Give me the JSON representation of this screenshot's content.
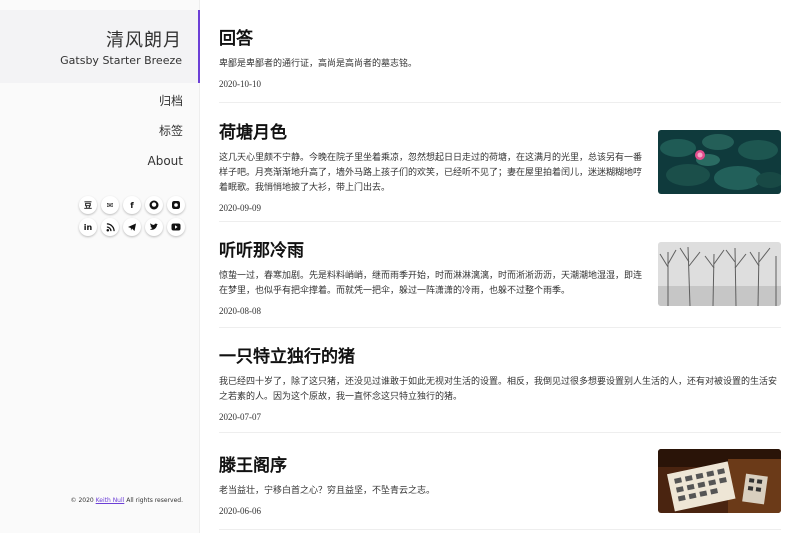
{
  "site": {
    "title": "清风朗月",
    "subtitle": "Gatsby Starter Breeze"
  },
  "nav": [
    {
      "label": "归档"
    },
    {
      "label": "标签"
    },
    {
      "label": "About"
    }
  ],
  "social": [
    {
      "icon": "douban-icon",
      "glyph": "豆"
    },
    {
      "icon": "mail-icon",
      "glyph": "✉"
    },
    {
      "icon": "facebook-icon",
      "glyph": "f"
    },
    {
      "icon": "github-icon",
      "glyph": "◉"
    },
    {
      "icon": "instagram-icon",
      "glyph": "◘"
    },
    {
      "icon": "linkedin-icon",
      "glyph": "in"
    },
    {
      "icon": "rss-icon",
      "glyph": "≋"
    },
    {
      "icon": "telegram-icon",
      "glyph": "➤"
    },
    {
      "icon": "twitter-icon",
      "glyph": "✦"
    },
    {
      "icon": "youtube-icon",
      "glyph": "▶"
    }
  ],
  "footer": {
    "prefix": "© 2020",
    "author": "Keith Null",
    "suffix": "All rights reserved."
  },
  "posts": [
    {
      "title": "回答",
      "excerpt": "卑鄙是卑鄙者的通行证，高尚是高尚者的墓志铭。",
      "date": "2020-10-10"
    },
    {
      "title": "荷塘月色",
      "excerpt": "这几天心里颇不宁静。今晚在院子里坐着乘凉，忽然想起日日走过的荷塘，在这满月的光里，总该另有一番样子吧。月亮渐渐地升高了，墙外马路上孩子们的欢笑，已经听不见了；妻在屋里拍着闰儿，迷迷糊糊地哼着眠歌。我悄悄地披了大衫，带上门出去。",
      "date": "2020-09-09",
      "thumb": "lotus-pond-image"
    },
    {
      "title": "听听那冷雨",
      "excerpt": "惊蛰一过，春寒加剧。先是料料峭峭，继而雨季开始，时而淋淋漓漓，时而淅淅沥沥，天潮潮地湿湿，即连在梦里，也似乎有把伞撑着。而就凭一把伞，躲过一阵潇潇的冷雨，也躲不过整个雨季。",
      "date": "2020-08-08",
      "thumb": "winter-trees-image"
    },
    {
      "title": "一只特立独行的猪",
      "excerpt": "我已经四十岁了，除了这只猪，还没见过谁敢于如此无视对生活的设置。相反，我倒见过很多想要设置别人生活的人，还有对被设置的生活安之若素的人。因为这个原故，我一直怀念这只特立独行的猪。",
      "date": "2020-07-07"
    },
    {
      "title": "滕王阁序",
      "excerpt": "老当益壮，宁移白首之心？穷且益坚，不坠青云之志。",
      "date": "2020-06-06",
      "thumb": "calligraphy-image"
    }
  ]
}
